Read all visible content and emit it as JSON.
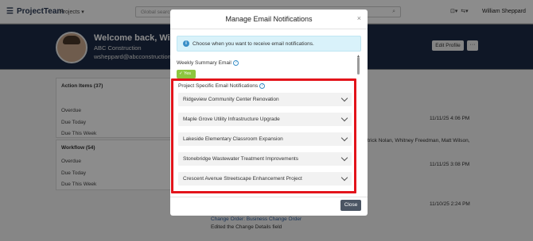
{
  "app": {
    "name": "ProjectTeam",
    "projects_menu": "Projects",
    "search_placeholder": "Global search",
    "user_menu": "William Sheppard"
  },
  "hero": {
    "welcome": "Welcome back, William",
    "company": "ABC Construction",
    "email": "wsheppard@abcconstruction",
    "edit_profile": "Edit Profile",
    "more": "···"
  },
  "background": {
    "action_items": {
      "title": "Action Items (37)",
      "rows": [
        "Overdue",
        "Due Today",
        "Due This Week"
      ]
    },
    "workflow": {
      "title": "Workflow (54)",
      "rows": [
        "Overdue",
        "Due Today",
        "Due This Week"
      ]
    },
    "feed": {
      "time1": "11/11/25 4:06 PM",
      "people": "trick Nolan, Whitney Freedman, Matt Wilson,",
      "time2": "11/11/25 3:08 PM",
      "time3": "11/10/25 2:24 PM",
      "change_order": "Change Order: Business Change Order",
      "edited": "Edited the Change Details field"
    }
  },
  "modal": {
    "title": "Manage Email Notifications",
    "close_x": "×",
    "info_text": "Choose when you want to receive email notifications.",
    "weekly_label": "Weekly Summary Email",
    "weekly_value": "Yes",
    "project_section_label": "Project Specific Email Notifications",
    "projects": [
      "Ridgeview Community Center Renovation",
      "Maple Grove Utility Infrastructure Upgrade",
      "Lakeside Elementary Classroom Expansion",
      "Stonebridge Wastewater Treatment Improvements",
      "Crescent Avenue Streetscape Enhancement Project"
    ],
    "close_button": "Close"
  },
  "colors": {
    "accent_blue": "#3a8fc7",
    "yes_green": "#8dc63f",
    "highlight_red": "#e3141b",
    "navy": "#1d2b45"
  }
}
